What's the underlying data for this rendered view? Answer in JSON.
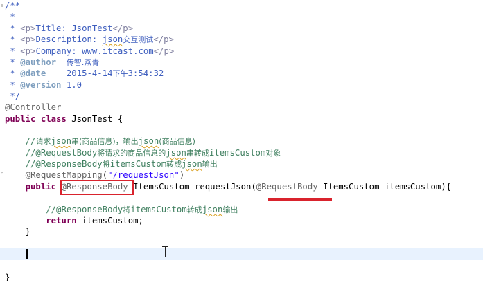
{
  "editor": {
    "lines": [
      {
        "text": "/**"
      },
      {
        "text": " *"
      },
      {
        "pre": " * ",
        "tag_open": "<p>",
        "body": "Title: JsonTest",
        "tag_close": "</p>"
      },
      {
        "pre": " * ",
        "tag_open": "<p>",
        "body": "Description: ",
        "squiggle": "json",
        "cjk": "交互测试",
        "tag_close": "</p>"
      },
      {
        "pre": " * ",
        "tag_open": "<p>",
        "body": "Company: www.itcast.com",
        "tag_close": "</p>"
      },
      {
        "pre": " * ",
        "jd_tag": "@author",
        "body": "  ",
        "cjk": "传智.燕青"
      },
      {
        "pre": " * ",
        "jd_tag": "@date",
        "body": "    2015-4-14",
        "cjk": "下午",
        "tail": "3:54:32"
      },
      {
        "pre": " * ",
        "jd_tag": "@version",
        "body": " 1.0"
      },
      {
        "text": " */"
      },
      {
        "text": "@Controller"
      },
      {
        "kw": "public class",
        "text": " JsonTest {"
      },
      {
        "text": ""
      },
      {
        "indent": "    ",
        "c1": "//",
        "cjk1": "请求",
        "sq": "json",
        "cjk2": "串(商品信息)，输出",
        "sq2": "json",
        "cjk3": "(商品信息)"
      },
      {
        "indent": "    ",
        "c1": "//@RequestBody",
        "cjk1": "将请求的商品信息的",
        "sq": "json",
        "cjk2": "串转成",
        "tail": "itemsCustom",
        "cjk3": "对象"
      },
      {
        "indent": "    ",
        "c1": "//@ResponseBody",
        "cjk1": "将",
        "tail": "itemsCustom",
        "cjk2": "转成",
        "sq": "json",
        "cjk3": "输出"
      },
      {
        "indent": "    ",
        "ann": "@RequestMapping",
        "paren_open": "(",
        "str": "\"/requestJson\"",
        "paren_close": ")"
      },
      {
        "indent": "    ",
        "kw": "public",
        "a1": "@ResponseBody",
        "mid": " ItemsCustom requestJson(",
        "a2": "@RequestBody",
        "end": " ItemsCustom itemsCustom){"
      },
      {
        "text": ""
      },
      {
        "indent": "        ",
        "c1": "//@ResponseBody",
        "cjk1": "将",
        "tail": "itemsCustom",
        "cjk2": "转成",
        "sq": "json",
        "cjk3": "输出"
      },
      {
        "indent": "        ",
        "kw": "return",
        "text": " itemsCustom;"
      },
      {
        "indent": "    ",
        "text": "}"
      },
      {
        "text": ""
      },
      {
        "text": ""
      },
      {
        "text": ""
      },
      {
        "text": "}"
      }
    ]
  }
}
